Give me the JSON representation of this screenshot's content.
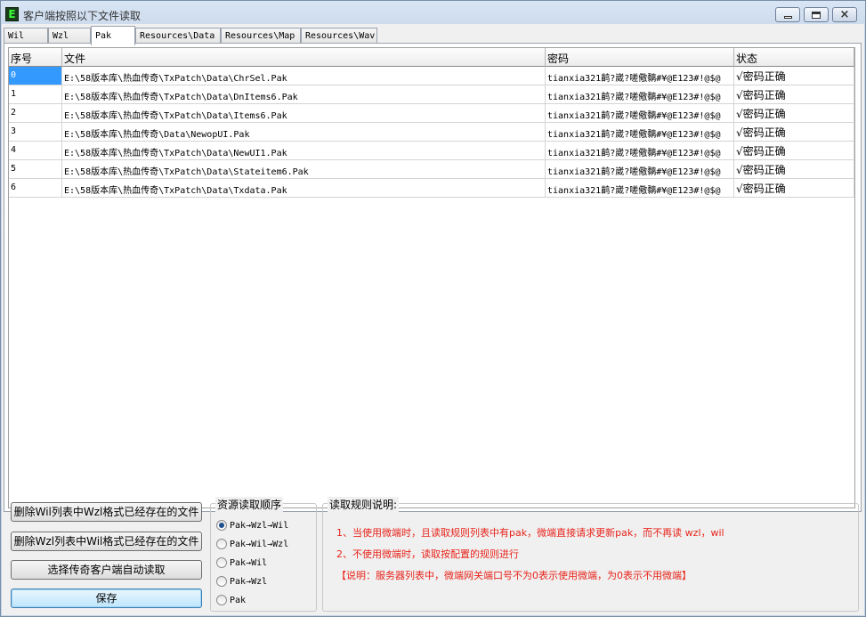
{
  "window": {
    "title": "客户端按照以下文件读取",
    "icon_letter": "E",
    "controls": [
      "minimize-icon",
      "maximize-icon",
      "close-icon"
    ],
    "close_glyph": "×"
  },
  "tabs": [
    {
      "label": "Wil",
      "active": false
    },
    {
      "label": "Wzl",
      "active": false
    },
    {
      "label": "Pak",
      "active": true
    },
    {
      "label": "Resources\\Data",
      "active": false
    },
    {
      "label": "Resources\\Map",
      "active": false
    },
    {
      "label": "Resources\\Wav",
      "active": false
    }
  ],
  "grid": {
    "headers": [
      "序号",
      "文件",
      "密码",
      "状态"
    ],
    "rows": [
      {
        "index": "0",
        "file": "E:\\58版本库\\热血传奇\\TxPatch\\Data\\ChrSel.Pak",
        "password": "tianxia321鹋?崴?嗟儆黐#¥@E123#!@$@",
        "status": "√密码正确"
      },
      {
        "index": "1",
        "file": "E:\\58版本库\\热血传奇\\TxPatch\\Data\\DnItems6.Pak",
        "password": "tianxia321鹋?崴?嗟儆黐#¥@E123#!@$@",
        "status": "√密码正确"
      },
      {
        "index": "2",
        "file": "E:\\58版本库\\热血传奇\\TxPatch\\Data\\Items6.Pak",
        "password": "tianxia321鹋?崴?嗟儆黐#¥@E123#!@$@",
        "status": "√密码正确"
      },
      {
        "index": "3",
        "file": "E:\\58版本库\\热血传奇\\Data\\NewopUI.Pak",
        "password": "tianxia321鹋?崴?嗟儆黐#¥@E123#!@$@",
        "status": "√密码正确"
      },
      {
        "index": "4",
        "file": "E:\\58版本库\\热血传奇\\TxPatch\\Data\\NewUI1.Pak",
        "password": "tianxia321鹋?崴?嗟儆黐#¥@E123#!@$@",
        "status": "√密码正确"
      },
      {
        "index": "5",
        "file": "E:\\58版本库\\热血传奇\\TxPatch\\Data\\Stateitem6.Pak",
        "password": "tianxia321鹋?崴?嗟儆黐#¥@E123#!@$@",
        "status": "√密码正确"
      },
      {
        "index": "6",
        "file": "E:\\58版本库\\热血传奇\\TxPatch\\Data\\Txdata.Pak",
        "password": "tianxia321鹋?崴?嗟儆黐#¥@E123#!@$@",
        "status": "√密码正确"
      }
    ],
    "selected_row": 0,
    "selection_color": "#3399ff"
  },
  "buttons": {
    "delete_wil": "删除Wil列表中Wzl格式已经存在的文件",
    "delete_wzl": "删除Wzl列表中Wil格式已经存在的文件",
    "auto_read": "选择传奇客户端自动读取",
    "save": "保存"
  },
  "order_group": {
    "title": "资源读取顺序",
    "options": [
      {
        "label": "Pak→Wzl→Wil",
        "checked": true
      },
      {
        "label": "Pak→Wil→Wzl",
        "checked": false
      },
      {
        "label": "Pak→Wil",
        "checked": false
      },
      {
        "label": "Pak→Wzl",
        "checked": false
      },
      {
        "label": "Pak",
        "checked": false
      }
    ]
  },
  "rules": {
    "title": "读取规则说明:",
    "lines": [
      "1、当使用微端时，且读取规则列表中有pak，微端直接请求更新pak，而不再读 wzl，wil",
      "2、不使用微端时，读取按配置的规则进行",
      "【说明：服务器列表中，微端网关端口号不为0表示使用微端，为0表示不用微端】"
    ],
    "text_color": "#e8241b"
  }
}
